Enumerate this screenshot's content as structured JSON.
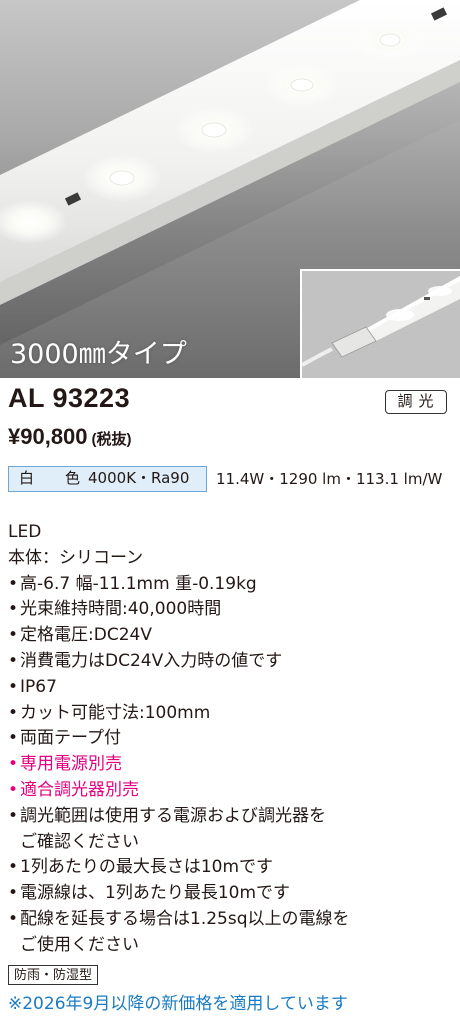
{
  "hero": {
    "caption": "3000㎜タイプ",
    "led_strip_image": "led-strip-closeup",
    "inset_image": "led-strip-connector-detail"
  },
  "product": {
    "model": "AL 93223",
    "dimming_badge": "調光",
    "price": "¥90,800",
    "price_tax": "(税抜)",
    "color_label": "白　色",
    "color_spec": "4000K・Ra90",
    "output_spec": "11.4W・1290 lm・113.1 lm/W"
  },
  "details": [
    {
      "text": "LED",
      "bullet": false,
      "pink": false,
      "indent": false
    },
    {
      "text": "本体：シリコーン",
      "bullet": false,
      "pink": false,
      "indent": false
    },
    {
      "text": "高-6.7 幅-11.1mm 重-0.19kg",
      "bullet": true,
      "pink": false,
      "indent": false
    },
    {
      "text": "光束維持時間:40,000時間",
      "bullet": true,
      "pink": false,
      "indent": false
    },
    {
      "text": "定格電圧:DC24V",
      "bullet": true,
      "pink": false,
      "indent": false
    },
    {
      "text": "消費電力はDC24V入力時の値です",
      "bullet": true,
      "pink": false,
      "indent": false
    },
    {
      "text": "IP67",
      "bullet": true,
      "pink": false,
      "indent": false
    },
    {
      "text": "カット可能寸法:100mm",
      "bullet": true,
      "pink": false,
      "indent": false
    },
    {
      "text": "両面テープ付",
      "bullet": true,
      "pink": false,
      "indent": false
    },
    {
      "text": "専用電源別売",
      "bullet": true,
      "pink": true,
      "indent": false
    },
    {
      "text": "適合調光器別売",
      "bullet": true,
      "pink": true,
      "indent": false
    },
    {
      "text": "調光範囲は使用する電源および調光器を",
      "bullet": true,
      "pink": false,
      "indent": false
    },
    {
      "text": "ご確認ください",
      "bullet": false,
      "pink": false,
      "indent": true
    },
    {
      "text": "1列あたりの最大長さは10mです",
      "bullet": true,
      "pink": false,
      "indent": false
    },
    {
      "text": "電源線は、1列あたり最長10mです",
      "bullet": true,
      "pink": false,
      "indent": false
    },
    {
      "text": "配線を延長する場合は1.25sq以上の電線を",
      "bullet": true,
      "pink": false,
      "indent": false
    },
    {
      "text": "ご使用ください",
      "bullet": false,
      "pink": false,
      "indent": true
    }
  ],
  "tag": "防雨・防湿型",
  "notice": "※2026年9月以降の新価格を適用しています",
  "colors": {
    "text": "#231815",
    "pink": "#e4007f",
    "notice": "#1a7bc4",
    "color_box_bg": "#dfeef8",
    "color_box_border": "#6ea7d4"
  }
}
